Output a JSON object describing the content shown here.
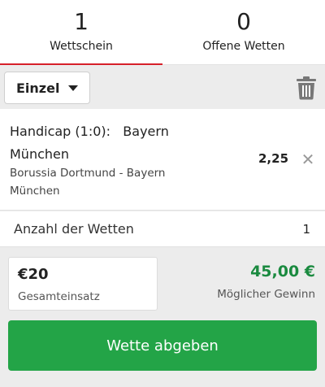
{
  "tabs": [
    {
      "count": "1",
      "label": "Wettschein",
      "active": true
    },
    {
      "count": "0",
      "label": "Offene Wetten",
      "active": false
    }
  ],
  "toolbar": {
    "bet_type": "Einzel",
    "trash_icon": "trash-icon"
  },
  "bet": {
    "selection": "Handicap (1:0):   Bayern\nMünchen",
    "event": "Borussia Dortmund - Bayern München",
    "odds": "2,25",
    "remove_icon": "close-icon"
  },
  "count_row": {
    "label": "Anzahl der Wetten",
    "value": "1"
  },
  "stake": {
    "amount": "€20",
    "label": "Gesamteinsatz"
  },
  "winnings": {
    "amount": "45,00 €",
    "label": "Möglicher Gewinn"
  },
  "submit_label": "Wette abgeben",
  "colors": {
    "accent_red": "#d6202a",
    "success_green": "#23a447",
    "winnings_green": "#1a8a3f"
  }
}
